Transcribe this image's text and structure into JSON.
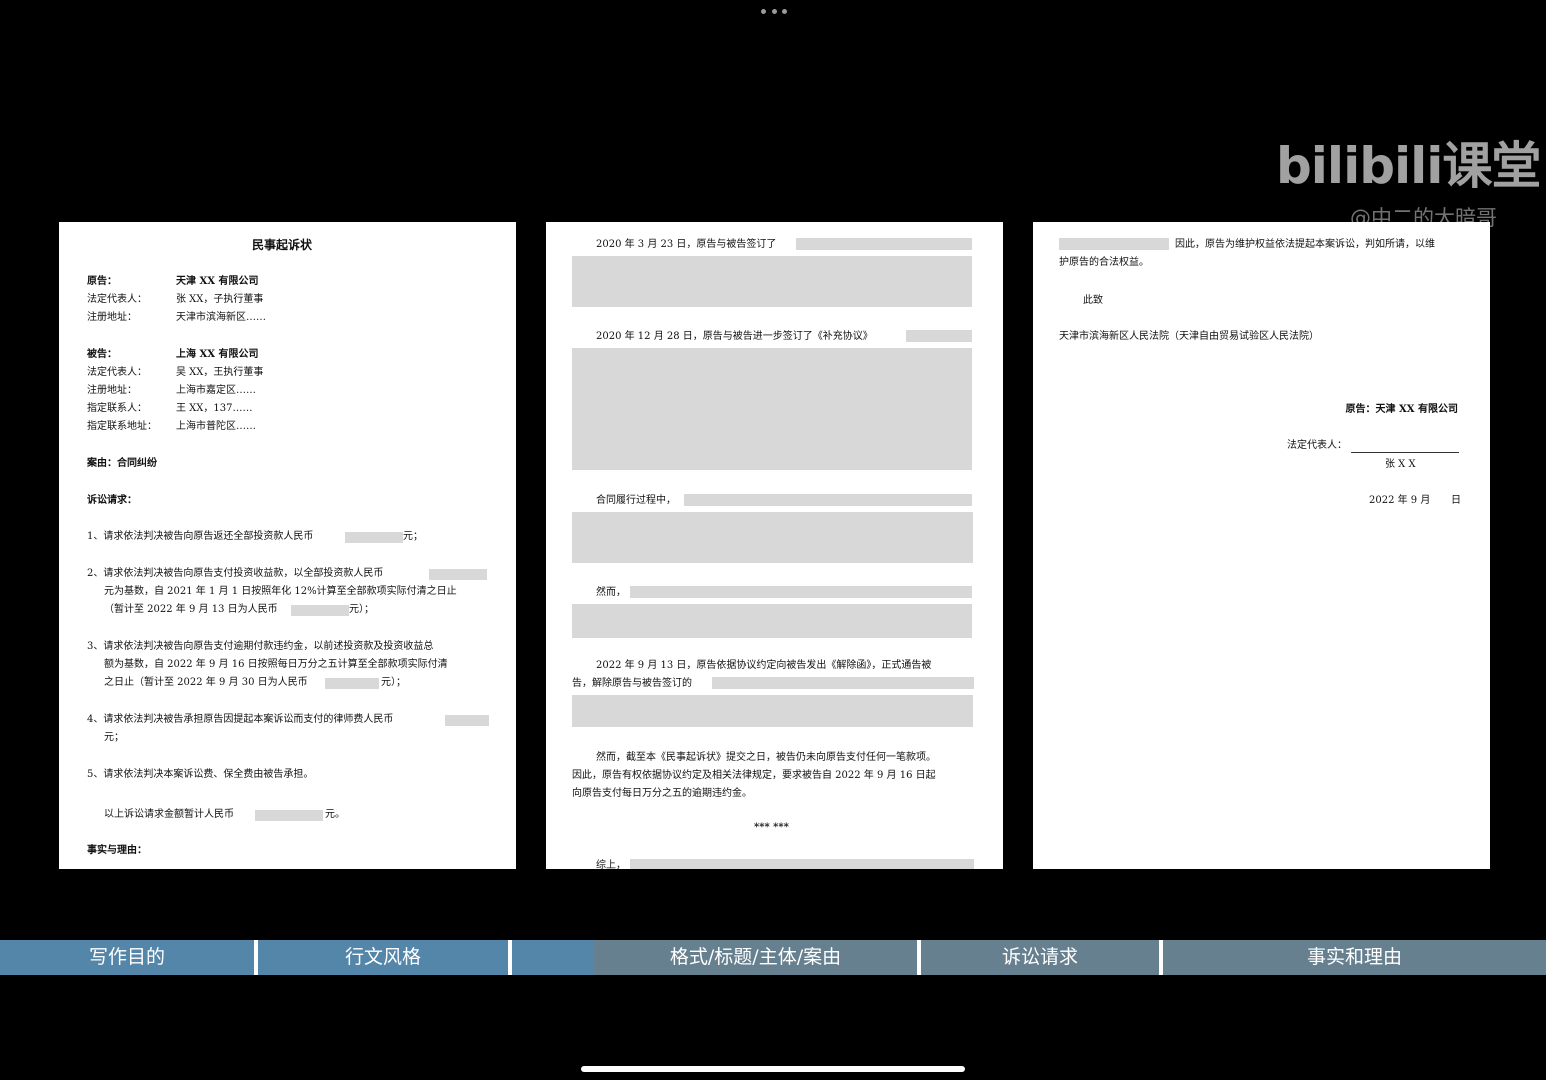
{
  "watermark": {
    "logo": "bilibili课堂",
    "user": "@中二的大暗哥"
  },
  "page1": {
    "title": "民事起诉状",
    "plaintiff_label": "原告：",
    "plaintiff_name": "天津 XX 有限公司",
    "p_rep_label": "法定代表人：",
    "p_rep_value": "张 XX，子执行董事",
    "p_addr_label": "注册地址：",
    "p_addr_value": "天津市滨海新区……",
    "defendant_label": "被告：",
    "defendant_name": "上海 XX 有限公司",
    "d_rep_label": "法定代表人：",
    "d_rep_value": "吴 XX，王执行董事",
    "d_addr_label": "注册地址：",
    "d_addr_value": "上海市嘉定区……",
    "d_contact_label": "指定联系人：",
    "d_contact_value": "王 XX，137……",
    "d_contact_addr_label": "指定联系地址：",
    "d_contact_addr_value": "上海市普陀区……",
    "cause": "案由：合同纠纷",
    "claims_heading": "诉讼请求：",
    "c1": "1、请求依法判决被告向原告返还全部投资款人民币",
    "c1_end": "元；",
    "c2_a": "2、请求依法判决被告向原告支付投资收益款，以全部投资款人民币",
    "c2_b": "元为基数，自 2021 年 1 月 1 日按照年化 12%计算至全部款项实际付清之日止",
    "c2_c": "（暂计至 2022 年 9 月 13 日为人民币",
    "c2_c_end": "元）；",
    "c3_a": "3、请求依法判决被告向原告支付逾期付款违约金，以前述投资款及投资收益总",
    "c3_b": "额为基数，自 2022 年 9 月 16 日按照每日万分之五计算至全部款项实际付清",
    "c3_c": "之日止（暂计至 2022 年 9 月 30 日为人民币",
    "c3_c_end": "元）；",
    "c4_a": "4、请求依法判决被告承担原告因提起本案诉讼而支付的律师费人民币",
    "c4_b": "元；",
    "c5": "5、请求依法判决本案诉讼费、保全费由被告承担。",
    "total": "以上诉讼请求金额暂计人民币",
    "total_end": "元。",
    "facts_heading": "事实与理由："
  },
  "page2": {
    "l1": "2020 年 3 月 23 日，原告与被告签订了",
    "l2": "2020 年 12 月 28 日，原告与被告进一步签订了《补充协议》",
    "l3": "合同履行过程中，",
    "l4": "然而，",
    "l5a": "2022 年 9 月 13 日，原告依据协议约定向被告发出《解除函》，正式通告被",
    "l5b": "告，解除原告与被告签订的",
    "l6a": "然而，截至本《民事起诉状》提交之日，被告仍未向原告支付任何一笔款项。",
    "l6b": "因此，原告有权依据协议约定及相关法律规定，要求被告自 2022 年 9 月 16 日起",
    "l6c": "向原告支付每日万分之五的逾期违约金。",
    "stars": "*** ***",
    "l7": "综上，"
  },
  "page3": {
    "l1_end": "因此，原告为维护权益依法提起本案诉讼，判如所请，以维",
    "l2": "护原告的合法权益。",
    "l3": "此致",
    "court": "天津市滨海新区人民法院（天津自由贸易试验区人民法院）",
    "sign_plaintiff": "原告：天津 XX 有限公司",
    "sign_rep": "法定代表人：",
    "sign_name": "张 X X",
    "sign_date": "2022 年 9 月",
    "sign_day": "日"
  },
  "tabs": [
    {
      "label": "写作目的",
      "color": "#5486a9"
    },
    {
      "label": "行文风格",
      "color": "#5486a9"
    },
    {
      "label": "",
      "color": "#5486a9"
    },
    {
      "label": "格式/标题/主体/案由",
      "color": "#66808f"
    },
    {
      "label": "诉讼请求",
      "color": "#66808f"
    },
    {
      "label": "事实和理由",
      "color": "#66808f"
    }
  ]
}
